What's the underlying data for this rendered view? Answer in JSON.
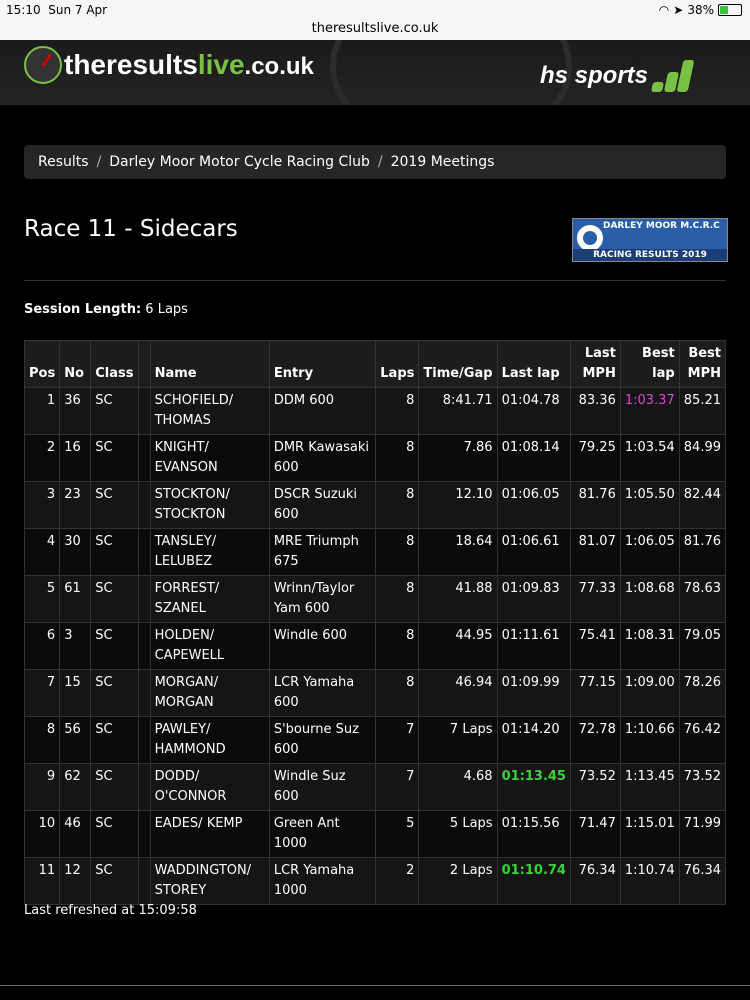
{
  "status": {
    "time": "15:10",
    "date": "Sun 7 Apr",
    "battery": "38%",
    "battery_level": 0.38
  },
  "url": "theresultslive.co.uk",
  "logo": {
    "the": "the",
    "results": "results",
    "live": "live",
    "tld": ".co.uk"
  },
  "sponsor": "hs sports",
  "breadcrumb": [
    "Results",
    "Darley Moor Motor Cycle Racing Club",
    "2019 Meetings"
  ],
  "title": "Race 11 - Sidecars",
  "club_logo": {
    "top": "DARLEY MOOR M.C.R.C",
    "bottom": "RACING RESULTS 2019"
  },
  "session": {
    "label": "Session Length:",
    "value": "6 Laps"
  },
  "table": {
    "headers": [
      "Pos",
      "No",
      "Class",
      "",
      "Name",
      "Entry",
      "Laps",
      "Time/Gap",
      "Last lap",
      "Last MPH",
      "Best lap",
      "Best MPH"
    ],
    "rows": [
      {
        "pos": "1",
        "no": "36",
        "cls": "SC",
        "name": "SCHOFIELD/ THOMAS",
        "entry": "DDM 600",
        "laps": "8",
        "gap": "8:41.71",
        "last": "01:04.78",
        "lmph": "83.36",
        "best": "1:03.37",
        "bmph": "85.21"
      },
      {
        "pos": "2",
        "no": "16",
        "cls": "SC",
        "name": "KNIGHT/ EVANSON",
        "entry": "DMR Kawasaki 600",
        "laps": "8",
        "gap": "7.86",
        "last": "01:08.14",
        "lmph": "79.25",
        "best": "1:03.54",
        "bmph": "84.99"
      },
      {
        "pos": "3",
        "no": "23",
        "cls": "SC",
        "name": "STOCKTON/ STOCKTON",
        "entry": "DSCR Suzuki 600",
        "laps": "8",
        "gap": "12.10",
        "last": "01:06.05",
        "lmph": "81.76",
        "best": "1:05.50",
        "bmph": "82.44"
      },
      {
        "pos": "4",
        "no": "30",
        "cls": "SC",
        "name": "TANSLEY/ LELUBEZ",
        "entry": "MRE Triumph 675",
        "laps": "8",
        "gap": "18.64",
        "last": "01:06.61",
        "lmph": "81.07",
        "best": "1:06.05",
        "bmph": "81.76"
      },
      {
        "pos": "5",
        "no": "61",
        "cls": "SC",
        "name": "FORREST/ SZANEL",
        "entry": "Wrinn/Taylor Yam 600",
        "laps": "8",
        "gap": "41.88",
        "last": "01:09.83",
        "lmph": "77.33",
        "best": "1:08.68",
        "bmph": "78.63"
      },
      {
        "pos": "6",
        "no": "3",
        "cls": "SC",
        "name": "HOLDEN/ CAPEWELL",
        "entry": "Windle 600",
        "laps": "8",
        "gap": "44.95",
        "last": "01:11.61",
        "lmph": "75.41",
        "best": "1:08.31",
        "bmph": "79.05"
      },
      {
        "pos": "7",
        "no": "15",
        "cls": "SC",
        "name": "MORGAN/ MORGAN",
        "entry": "LCR Yamaha 600",
        "laps": "8",
        "gap": "46.94",
        "last": "01:09.99",
        "lmph": "77.15",
        "best": "1:09.00",
        "bmph": "78.26"
      },
      {
        "pos": "8",
        "no": "56",
        "cls": "SC",
        "name": "PAWLEY/ HAMMOND",
        "entry": "S'bourne Suz 600",
        "laps": "7",
        "gap": "7 Laps",
        "last": "01:14.20",
        "lmph": "72.78",
        "best": "1:10.66",
        "bmph": "76.42"
      },
      {
        "pos": "9",
        "no": "62",
        "cls": "SC",
        "name": "DODD/ O'CONNOR",
        "entry": "Windle Suz 600",
        "laps": "7",
        "gap": "4.68",
        "last": "01:13.45",
        "lmph": "73.52",
        "best": "1:13.45",
        "bmph": "73.52"
      },
      {
        "pos": "10",
        "no": "46",
        "cls": "SC",
        "name": "EADES/ KEMP",
        "entry": "Green Ant 1000",
        "laps": "5",
        "gap": "5 Laps",
        "last": "01:15.56",
        "lmph": "71.47",
        "best": "1:15.01",
        "bmph": "71.99"
      },
      {
        "pos": "11",
        "no": "12",
        "cls": "SC",
        "name": "WADDINGTON/ STOREY",
        "entry": "LCR Yamaha 1000",
        "laps": "2",
        "gap": "2 Laps",
        "last": "01:10.74",
        "lmph": "76.34",
        "best": "1:10.74",
        "bmph": "76.34"
      }
    ]
  },
  "refreshed": "Last refreshed at 15:09:58",
  "colors": {
    "best_overall": "#e040e0",
    "personal_best": "#39d239",
    "accent": "#7ac143"
  }
}
